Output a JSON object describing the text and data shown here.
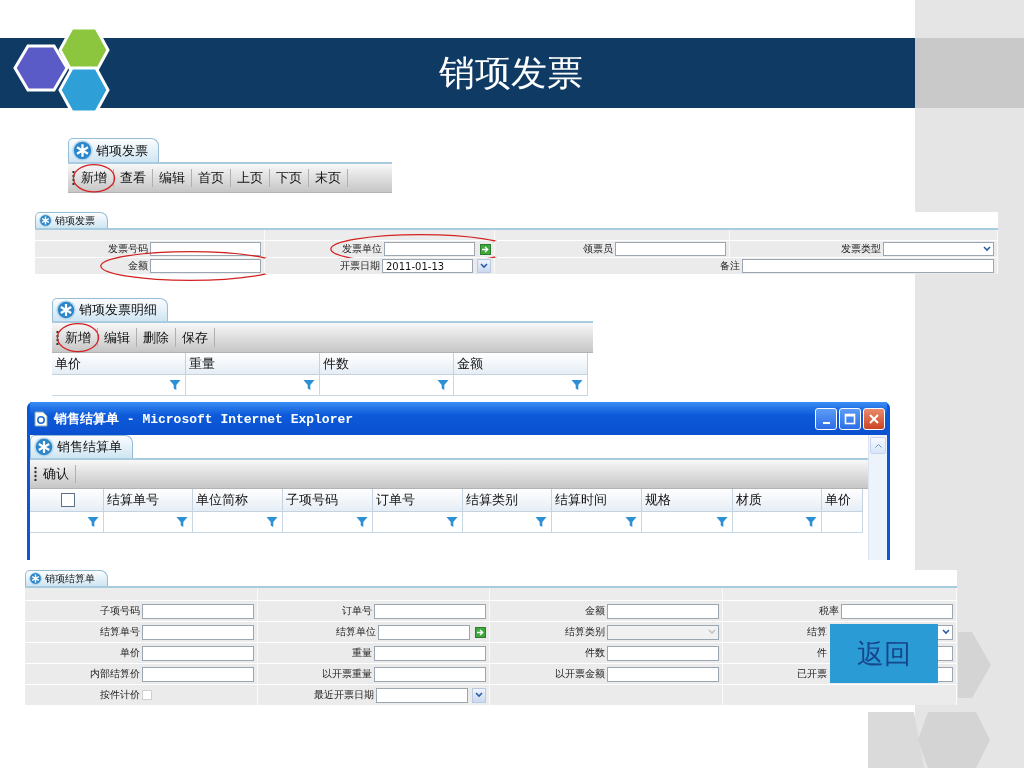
{
  "slide": {
    "title": "销项发票"
  },
  "list_view": {
    "tab": "销项发票",
    "toolbar": [
      {
        "label": "新增",
        "circled": true
      },
      {
        "label": "查看",
        "circled": false
      },
      {
        "label": "编辑",
        "circled": false
      },
      {
        "label": "首页",
        "circled": false
      },
      {
        "label": "上页",
        "circled": false
      },
      {
        "label": "下页",
        "circled": false
      },
      {
        "label": "末页",
        "circled": false
      }
    ]
  },
  "invoice_form": {
    "tab": "销项发票",
    "rows": [
      [
        {
          "label": "发票号码",
          "kind": "text",
          "circled": false
        },
        {
          "label": "发票单位",
          "kind": "lookup",
          "circled": true
        },
        {
          "label": "领票员",
          "kind": "text",
          "circled": false
        },
        {
          "label": "发票类型",
          "kind": "select",
          "circled": false
        }
      ],
      [
        {
          "label": "金额",
          "kind": "text",
          "circled": true
        },
        {
          "label": "开票日期",
          "kind": "date",
          "value": "2011-01-13",
          "circled": false
        },
        {
          "label": "备注",
          "kind": "wide",
          "circled": false
        }
      ]
    ]
  },
  "detail_grid": {
    "tab": "销项发票明细",
    "toolbar": [
      {
        "label": "新增",
        "circled": true
      },
      {
        "label": "编辑",
        "circled": false
      },
      {
        "label": "删除",
        "circled": false
      },
      {
        "label": "保存",
        "circled": false
      }
    ],
    "columns": [
      {
        "kind": "text",
        "label": "单价",
        "filter": true
      },
      {
        "kind": "text",
        "label": "重量",
        "filter": true
      },
      {
        "kind": "text",
        "label": "件数",
        "filter": true
      },
      {
        "kind": "text",
        "label": "金额",
        "filter": true
      }
    ]
  },
  "settlement_window": {
    "title": "销售结算单 - Microsoft Internet Explorer",
    "tab": "销售结算单",
    "toolbar": [
      {
        "label": "确认",
        "circled": false
      }
    ],
    "columns": [
      {
        "kind": "checkbox",
        "checked": false,
        "filter": true
      },
      {
        "kind": "text",
        "label": "结算单号",
        "filter": true
      },
      {
        "kind": "text",
        "label": "单位简称",
        "filter": true
      },
      {
        "kind": "text",
        "label": "子项号码",
        "filter": true
      },
      {
        "kind": "text",
        "label": "订单号",
        "filter": true
      },
      {
        "kind": "text",
        "label": "结算类别",
        "filter": true
      },
      {
        "kind": "text",
        "label": "结算时间",
        "filter": true
      },
      {
        "kind": "text",
        "label": "规格",
        "filter": true
      },
      {
        "kind": "text",
        "label": "材质",
        "filter": true
      },
      {
        "kind": "text",
        "label": "单价",
        "filter": false
      }
    ]
  },
  "settlement_form": {
    "tab": "销项结算单",
    "rows": [
      [
        {
          "label": "子项号码",
          "kind": "text",
          "disabled": false,
          "partial": false
        },
        {
          "label": "订单号",
          "kind": "text",
          "disabled": false,
          "partial": false
        },
        {
          "label": "金额",
          "kind": "text",
          "disabled": false,
          "partial": false
        },
        {
          "label": "税率",
          "kind": "text",
          "disabled": false,
          "partial": false
        }
      ],
      [
        {
          "label": "结算单号",
          "kind": "text",
          "disabled": false,
          "partial": false
        },
        {
          "label": "结算单位",
          "kind": "lookup",
          "disabled": false,
          "partial": false
        },
        {
          "label": "结算类别",
          "kind": "select",
          "disabled": true,
          "partial": false
        },
        {
          "label": "结算",
          "kind": "select",
          "disabled": false,
          "partial": true
        }
      ],
      [
        {
          "label": "单价",
          "kind": "text",
          "disabled": false,
          "partial": false
        },
        {
          "label": "重量",
          "kind": "text",
          "disabled": false,
          "partial": false
        },
        {
          "label": "件数",
          "kind": "text",
          "disabled": false,
          "partial": false
        },
        {
          "label": "件",
          "kind": "text",
          "disabled": false,
          "partial": true
        }
      ],
      [
        {
          "label": "内部结算价",
          "kind": "text",
          "disabled": false,
          "partial": false
        },
        {
          "label": "以开票重量",
          "kind": "text",
          "disabled": false,
          "partial": false
        },
        {
          "label": "以开票金额",
          "kind": "text",
          "disabled": false,
          "partial": false
        },
        {
          "label": "已开票",
          "kind": "text",
          "disabled": false,
          "partial": true
        }
      ],
      [
        {
          "label": "按件计价",
          "kind": "checkbox",
          "checked": false,
          "disabled": false
        },
        {
          "label": "最近开票日期",
          "kind": "date",
          "disabled": false,
          "partial": false
        }
      ]
    ]
  },
  "back_button": {
    "label": "返回"
  }
}
